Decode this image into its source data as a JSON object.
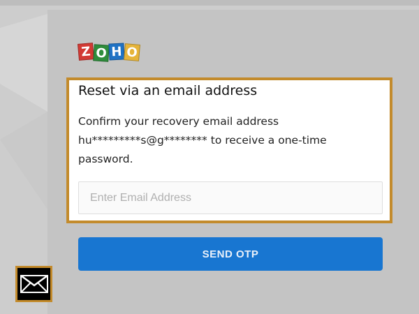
{
  "logo": {
    "letters": [
      "Z",
      "O",
      "H",
      "O"
    ]
  },
  "reset": {
    "title": "Reset via an email address",
    "description_line1": "Confirm your recovery email address",
    "description_line2": "hu*********s@g******** to receive a one-time",
    "description_line3": "password.",
    "email_placeholder": "Enter Email Address",
    "email_value": ""
  },
  "actions": {
    "send_label": "SEND OTP"
  },
  "colors": {
    "accent_border": "#c38b2c",
    "button": "#1876d1"
  },
  "icons": {
    "badge": "mail-icon"
  }
}
